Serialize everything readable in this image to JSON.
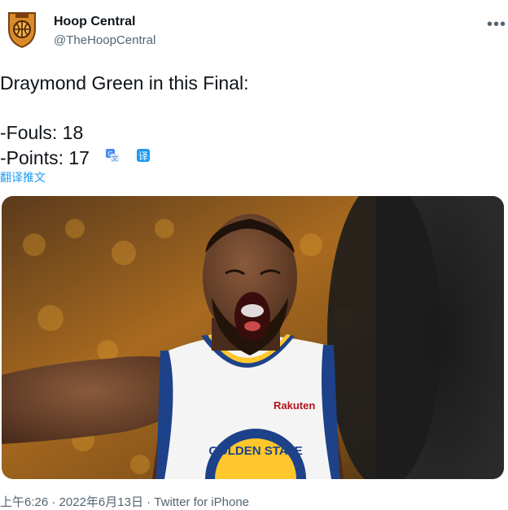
{
  "author": {
    "display_name": "Hoop Central",
    "handle": "@TheHoopCentral",
    "avatar_icon": "hoop-central-logo"
  },
  "more_icon": "more-dots-icon",
  "tweet": {
    "line1": "Draymond Green in this Final:",
    "line2": "-Fouls: 18",
    "line3": "-Points: 17"
  },
  "translate_icons": [
    "translate-icon",
    "translate-badge-icon"
  ],
  "translate_link": "翻译推文",
  "media": {
    "jersey_sponsor": "Rakuten",
    "jersey_team": "GOLDEN STATE"
  },
  "footer": {
    "time": "上午6:26",
    "sep1": " · ",
    "date": "2022年6月13日",
    "sep2": " · ",
    "source": "Twitter for iPhone"
  },
  "colors": {
    "link": "#1d9bf0",
    "muted": "#536471",
    "text": "#0f1419",
    "jersey_blue": "#1d428a",
    "jersey_gold": "#ffc72c"
  }
}
